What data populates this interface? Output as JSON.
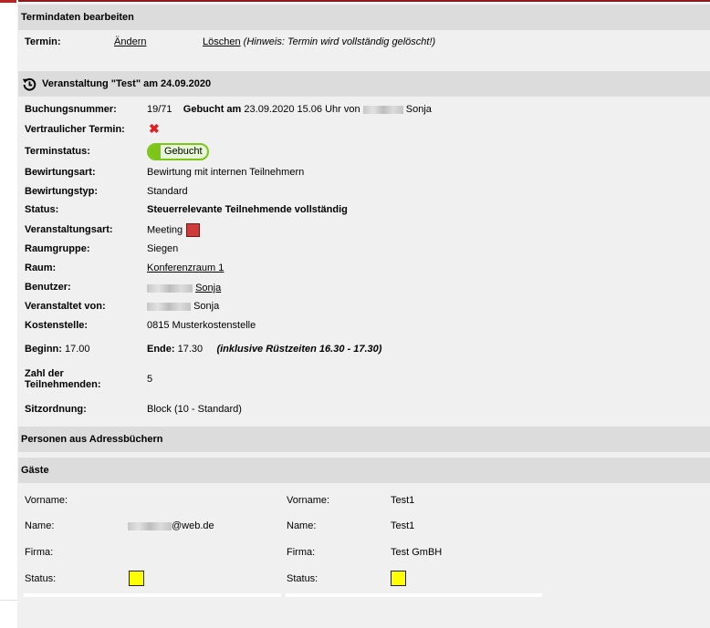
{
  "termindaten": {
    "header": "Termindaten bearbeiten",
    "termin_label": "Termin:",
    "aendern": "Ändern",
    "loeschen": "Löschen",
    "hinweis": "(Hinweis: Termin wird vollständig gelöscht!)"
  },
  "veranstaltung": {
    "header": "Veranstaltung \"Test\" am 24.09.2020",
    "buchungsnummer_label": "Buchungsnummer:",
    "buchungsnummer": "19/71",
    "gebucht_am_label": "Gebucht am",
    "gebucht_am_value": "23.09.2020 15.06 Uhr",
    "von_label": "von",
    "gebucht_von_name": "Sonja",
    "vertraulich_label": "Vertraulicher Termin:",
    "vertraulich_icon": "x-icon",
    "terminstatus_label": "Terminstatus:",
    "terminstatus": "Gebucht",
    "bewirtungsart_label": "Bewirtungsart:",
    "bewirtungsart": "Bewirtung mit internen Teilnehmern",
    "bewirtungstyp_label": "Bewirtungstyp:",
    "bewirtungstyp": "Standard",
    "status_label": "Status:",
    "status": "Steuerrelevante Teilnehmende vollständig",
    "veranstaltungsart_label": "Veranstaltungsart:",
    "veranstaltungsart": "Meeting",
    "veranstaltungsart_color": "#d03a3a",
    "raumgruppe_label": "Raumgruppe:",
    "raumgruppe": "Siegen",
    "raum_label": "Raum:",
    "raum": "Konferenzraum 1",
    "benutzer_label": "Benutzer:",
    "benutzer": "Sonja",
    "veranstaltet_label": "Veranstaltet von:",
    "veranstaltet": "Sonja",
    "kostenstelle_label": "Kostenstelle:",
    "kostenstelle": "0815 Musterkostenstelle",
    "beginn_label": "Beginn:",
    "beginn": "17.00",
    "ende_label": "Ende:",
    "ende": "17.30",
    "ruestzeiten": "(inklusive Rüstzeiten 16.30 - 17.30)",
    "teilnehmende_label_1": "Zahl der",
    "teilnehmende_label_2": "Teilnehmenden:",
    "teilnehmende": "5",
    "sitzordnung_label": "Sitzordnung:",
    "sitzordnung": "Block (10 - Standard)"
  },
  "personen": {
    "header": "Personen aus Adressbüchern"
  },
  "gaeste": {
    "header": "Gäste",
    "guests": [
      {
        "vorname_label": "Vorname:",
        "vorname": "",
        "name_label": "Name:",
        "name": "@web.de",
        "firma_label": "Firma:",
        "firma": "",
        "status_label": "Status:",
        "status_color": "#ffff00"
      },
      {
        "vorname_label": "Vorname:",
        "vorname": "Test1",
        "name_label": "Name:",
        "name": "Test1",
        "firma_label": "Firma:",
        "firma": "Test GmBH",
        "status_label": "Status:",
        "status_color": "#ffff00"
      }
    ]
  }
}
